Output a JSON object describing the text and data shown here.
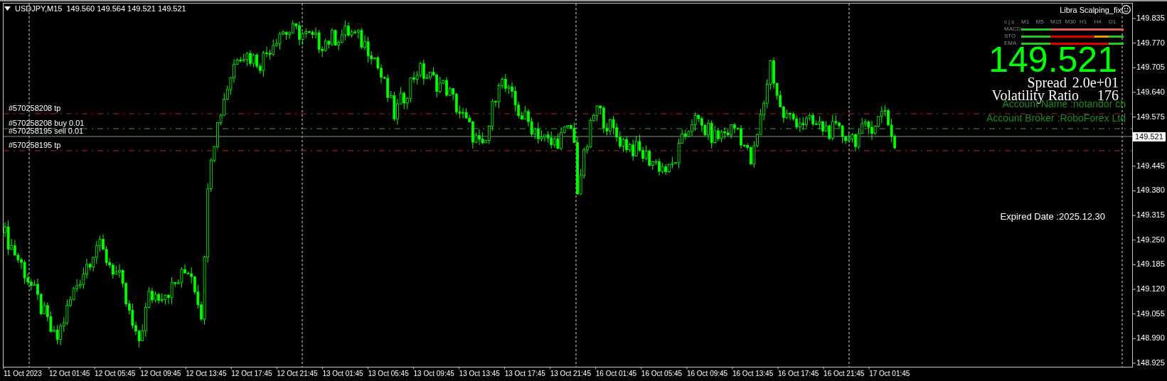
{
  "symbol_bar": {
    "symbol": "USDJPY,M15",
    "ohlc": "149.560 149.564 149.521 149.521"
  },
  "indicator": {
    "title": "Libra Scalping_fix",
    "table": {
      "header": "c j s",
      "columns": [
        "M1",
        "M5",
        "M15",
        "M30",
        "H1",
        "H4",
        "D1"
      ],
      "rows": [
        {
          "label": "MACD",
          "cells": [
            {
              "color": "#22cc22"
            },
            {
              "color": "#22cc22"
            },
            {
              "color": "#e06050"
            },
            {
              "color": "#e06050"
            },
            {
              "color": "#e06050"
            },
            {
              "color": "#e06050"
            },
            {
              "color": "#e06050"
            }
          ]
        },
        {
          "label": "STO",
          "cells": [
            {
              "color": "#22cc22"
            },
            {
              "color": "#22cc22"
            },
            {
              "color": "#dd0000"
            },
            {
              "color": "#dd0000"
            },
            {
              "color": "#dd0000"
            },
            {
              "color": "#e0a000"
            },
            {
              "color": "#22cc22"
            }
          ]
        },
        {
          "label": "EMA",
          "cells": [
            {
              "color": "#22cc22"
            },
            {
              "color": "#22cc22"
            },
            {
              "color": "#dd0000"
            },
            {
              "color": "#dd0000"
            },
            {
              "color": "#dd0000"
            },
            {
              "color": "#dd0000"
            },
            {
              "color": "#22cc22"
            }
          ]
        }
      ]
    },
    "price": "149.521",
    "spread_label": "Spread",
    "spread_value": "2.0e+01",
    "volatility_label": "Volatility Ratio",
    "volatility_value": "176",
    "account_name": "Account Name :notandor ch",
    "account_broker": "Account Broker :RoboForex Ltd",
    "expired_date": "Expired Date :2025.12.30"
  },
  "order_lines": [
    {
      "label": "#570258208 tp",
      "kind": "tp"
    },
    {
      "label": "#570258208 buy 0.01",
      "kind": "buy"
    },
    {
      "label": "#570258195 sell 0.01",
      "kind": "sell"
    },
    {
      "label": "#570258195 tp",
      "kind": "tp"
    }
  ],
  "price_axis": {
    "labels": [
      "149.835",
      "149.770",
      "149.705",
      "149.640",
      "149.575",
      "149.445",
      "149.380",
      "149.315",
      "149.250",
      "149.185",
      "149.120",
      "149.055",
      "148.990",
      "148.925"
    ],
    "current": "149.521"
  },
  "time_axis": {
    "labels": [
      "11 Oct 2023",
      "12 Oct 01:45",
      "12 Oct 05:45",
      "12 Oct 09:45",
      "12 Oct 13:45",
      "12 Oct 17:45",
      "12 Oct 21:45",
      "13 Oct 01:45",
      "13 Oct 05:45",
      "13 Oct 09:45",
      "13 Oct 13:45",
      "13 Oct 17:45",
      "13 Oct 21:45",
      "16 Oct 01:45",
      "16 Oct 05:45",
      "16 Oct 09:45",
      "16 Oct 13:45",
      "16 Oct 17:45",
      "16 Oct 21:45",
      "17 Oct 01:45"
    ]
  }
}
